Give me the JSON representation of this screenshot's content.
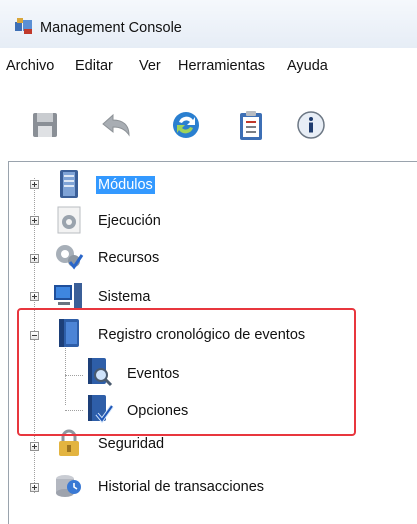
{
  "window": {
    "title": "Management Console"
  },
  "menu": [
    {
      "label": "Archivo"
    },
    {
      "label": "Editar"
    },
    {
      "label": "Ver"
    },
    {
      "label": "Herramientas"
    },
    {
      "label": "Ayuda"
    }
  ],
  "toolbar": [
    {
      "icon": "save-icon"
    },
    {
      "icon": "undo-icon"
    },
    {
      "icon": "refresh-icon"
    },
    {
      "icon": "clipboard-icon"
    },
    {
      "icon": "info-icon"
    }
  ],
  "tree": {
    "nodes": [
      {
        "label": "Módulos",
        "icon": "server-icon",
        "expanded": false,
        "selected": true
      },
      {
        "label": "Ejecución",
        "icon": "gear-icon",
        "expanded": false
      },
      {
        "label": "Recursos",
        "icon": "gears-check-icon",
        "expanded": false
      },
      {
        "label": "Sistema",
        "icon": "computer-icon",
        "expanded": false
      },
      {
        "label": "Registro cronológico de eventos",
        "icon": "book-icon",
        "expanded": true,
        "children": [
          {
            "label": "Eventos",
            "icon": "book-search-icon"
          },
          {
            "label": "Opciones",
            "icon": "book-check-icon"
          }
        ]
      },
      {
        "label": "Seguridad",
        "icon": "lock-icon",
        "expanded": false
      },
      {
        "label": "Historial de transacciones",
        "icon": "database-clock-icon",
        "expanded": false
      }
    ]
  },
  "colors": {
    "highlight": "#e8363e",
    "selection": "#3399ff"
  }
}
